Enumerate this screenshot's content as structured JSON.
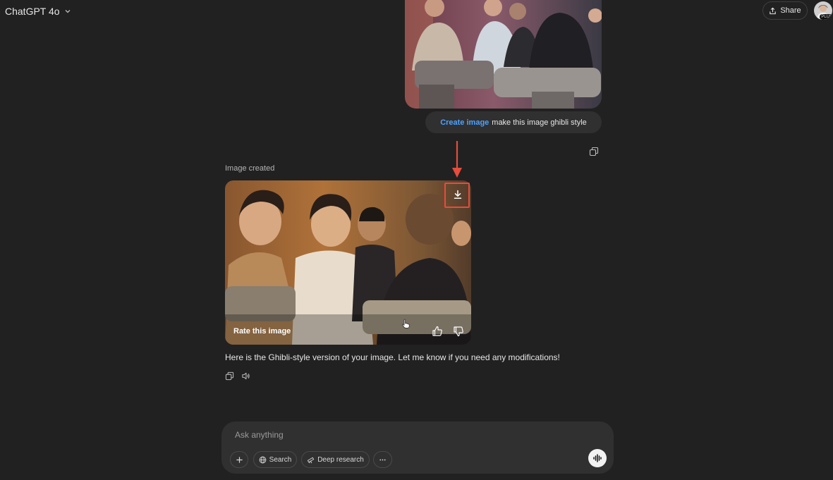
{
  "header": {
    "model_name": "ChatGPT 4o",
    "share_label": "Share",
    "avatar_badge": "PLUS"
  },
  "user_message": {
    "tag": "Create image",
    "prompt": "make this image ghibli style"
  },
  "assistant": {
    "status": "Image created",
    "rate_label": "Rate this image",
    "response_text": "Here is the Ghibli-style version of your image. Let me know if you need any modifications!"
  },
  "composer": {
    "placeholder": "Ask anything",
    "search_label": "Search",
    "deep_research_label": "Deep research"
  },
  "colors": {
    "background": "#212121",
    "bubble": "#303030",
    "accent_link": "#4ea1ff",
    "annotation": "#e74c3c"
  },
  "icons": [
    "chevron-down-icon",
    "share-icon",
    "copy-icon",
    "download-icon",
    "thumbs-up-icon",
    "thumbs-down-icon",
    "speaker-icon",
    "plus-icon",
    "globe-icon",
    "telescope-icon",
    "more-icon",
    "voice-icon",
    "cursor-icon"
  ]
}
